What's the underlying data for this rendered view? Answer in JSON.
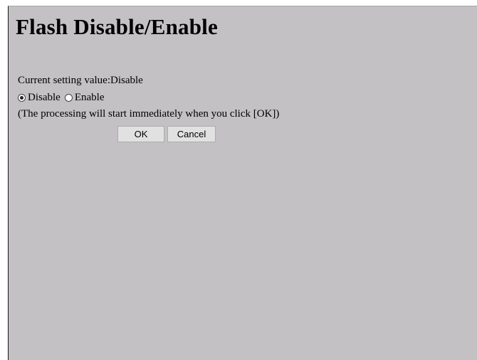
{
  "page": {
    "title": "Flash Disable/Enable"
  },
  "setting": {
    "label": "Current setting value",
    "separator": ":",
    "value": "Disable"
  },
  "options": [
    {
      "label": "Disable",
      "checked": true
    },
    {
      "label": "Enable",
      "checked": false
    }
  ],
  "note": "(The processing will start immediately when you click [OK])",
  "buttons": {
    "ok": "OK",
    "cancel": "Cancel"
  },
  "colors": {
    "background": "#c3c1c3",
    "button": "#e1e1e1"
  }
}
